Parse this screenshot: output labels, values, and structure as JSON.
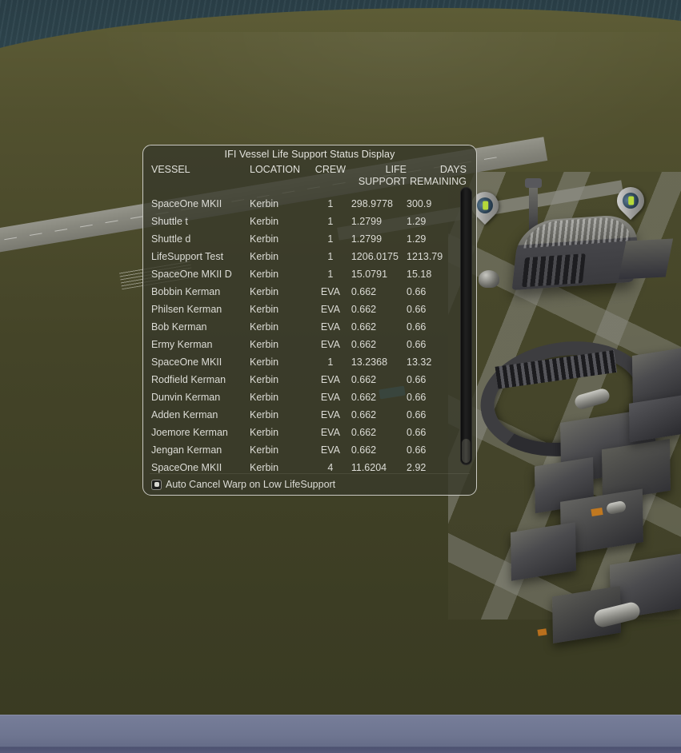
{
  "scene": {
    "name": "ksc-overview",
    "water_color": "#2f4750",
    "land_color": "#44442a",
    "pavement_color": "#969690",
    "bottom_bar_color": "#6e7590",
    "markers": [
      "vessel-marker-pin",
      "vessel-marker-pin"
    ]
  },
  "panel": {
    "title": "IFI Vessel Life Support Status Display",
    "columns": {
      "vessel": "VESSEL",
      "location": "LOCATION",
      "crew": "CREW",
      "life_support_l1": "LIFE",
      "life_support_l2": "SUPPORT",
      "days_l1": "DAYS",
      "days_l2": "REMAINING"
    },
    "rows": [
      {
        "vessel": "SpaceOne MKII",
        "location": "Kerbin",
        "crew": "1",
        "life_support": "298.9778",
        "days_remaining": "300.9"
      },
      {
        "vessel": "Shuttle t",
        "location": "Kerbin",
        "crew": "1",
        "life_support": "1.2799",
        "days_remaining": "1.29"
      },
      {
        "vessel": "Shuttle d",
        "location": "Kerbin",
        "crew": "1",
        "life_support": "1.2799",
        "days_remaining": "1.29"
      },
      {
        "vessel": "LifeSupport Test",
        "location": "Kerbin",
        "crew": "1",
        "life_support": "1206.0175",
        "days_remaining": "1213.79"
      },
      {
        "vessel": "SpaceOne MKII D",
        "location": "Kerbin",
        "crew": "1",
        "life_support": "15.0791",
        "days_remaining": "15.18"
      },
      {
        "vessel": "Bobbin Kerman",
        "location": "Kerbin",
        "crew": "EVA",
        "life_support": "0.662",
        "days_remaining": "0.66"
      },
      {
        "vessel": "Philsen Kerman",
        "location": "Kerbin",
        "crew": "EVA",
        "life_support": "0.662",
        "days_remaining": "0.66"
      },
      {
        "vessel": "Bob Kerman",
        "location": "Kerbin",
        "crew": "EVA",
        "life_support": "0.662",
        "days_remaining": "0.66"
      },
      {
        "vessel": "Ermy Kerman",
        "location": "Kerbin",
        "crew": "EVA",
        "life_support": "0.662",
        "days_remaining": "0.66"
      },
      {
        "vessel": "SpaceOne MKII",
        "location": "Kerbin",
        "crew": "1",
        "life_support": "13.2368",
        "days_remaining": "13.32"
      },
      {
        "vessel": "Rodfield Kerman",
        "location": "Kerbin",
        "crew": "EVA",
        "life_support": "0.662",
        "days_remaining": "0.66"
      },
      {
        "vessel": "Dunvin Kerman",
        "location": "Kerbin",
        "crew": "EVA",
        "life_support": "0.662",
        "days_remaining": "0.66"
      },
      {
        "vessel": "Adden Kerman",
        "location": "Kerbin",
        "crew": "EVA",
        "life_support": "0.662",
        "days_remaining": "0.66"
      },
      {
        "vessel": "Joemore Kerman",
        "location": "Kerbin",
        "crew": "EVA",
        "life_support": "0.662",
        "days_remaining": "0.66"
      },
      {
        "vessel": "Jengan Kerman",
        "location": "Kerbin",
        "crew": "EVA",
        "life_support": "0.662",
        "days_remaining": "0.66"
      },
      {
        "vessel": "SpaceOne MKII",
        "location": "Kerbin",
        "crew": "4",
        "life_support": "11.6204",
        "days_remaining": "2.92"
      }
    ],
    "footer": {
      "auto_cancel_warp_label": "Auto Cancel Warp on Low LifeSupport",
      "auto_cancel_warp_checked": true
    },
    "scrollbar": {
      "thumb_position": "bottom"
    }
  }
}
